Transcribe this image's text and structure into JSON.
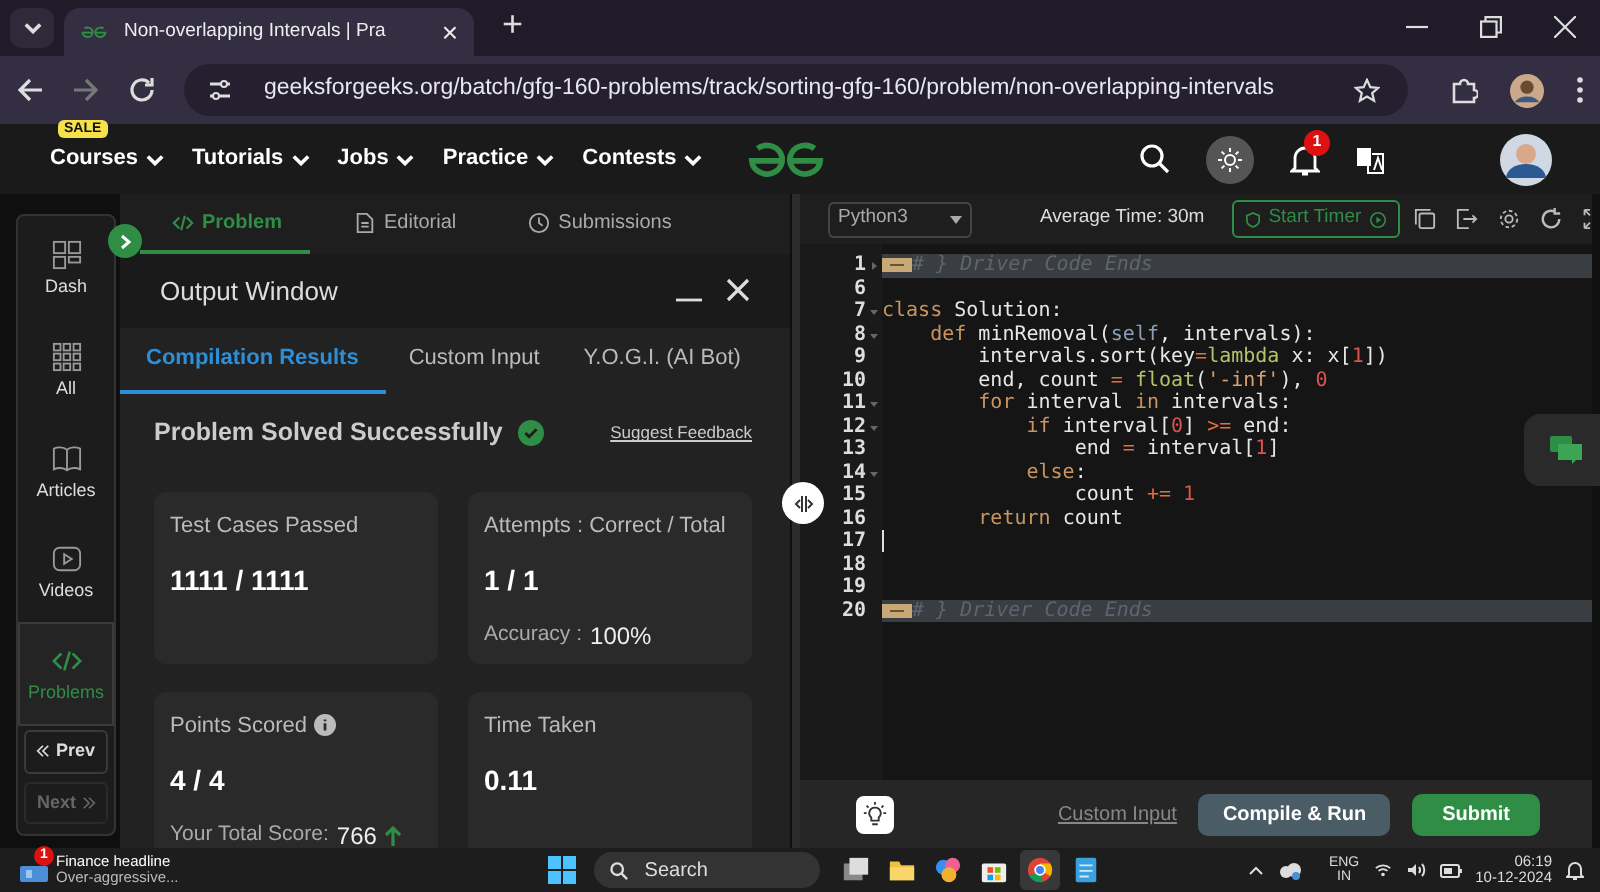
{
  "browser": {
    "tab": {
      "title": "Non-overlapping Intervals | Pra",
      "close": "×"
    },
    "new_tab": "+",
    "url": "geeksforgeeks.org/batch/gfg-160-problems/track/sorting-gfg-160/problem/non-overlapping-intervals"
  },
  "site_nav": {
    "items": [
      {
        "label": "Courses",
        "badge": "SALE"
      },
      {
        "label": "Tutorials"
      },
      {
        "label": "Jobs"
      },
      {
        "label": "Practice"
      },
      {
        "label": "Contests"
      }
    ],
    "notifications": "1"
  },
  "sidebar": {
    "items": [
      {
        "label": "Dash",
        "selected": false
      },
      {
        "label": "All",
        "selected": false
      },
      {
        "label": "Articles",
        "selected": false
      },
      {
        "label": "Videos",
        "selected": false
      },
      {
        "label": "Problems",
        "selected": true
      }
    ],
    "prev": {
      "label": "Prev",
      "disabled": false
    },
    "next": {
      "label": "Next",
      "disabled": true
    }
  },
  "problem_tabs": [
    {
      "label": "Problem",
      "selected": true
    },
    {
      "label": "Editorial",
      "selected": false
    },
    {
      "label": "Submissions",
      "selected": false
    }
  ],
  "output_window": {
    "title": "Output Window",
    "tabs": [
      {
        "label": "Compilation Results",
        "selected": true
      },
      {
        "label": "Custom Input",
        "selected": false
      },
      {
        "label": "Y.O.G.I. (AI Bot)",
        "selected": false
      }
    ],
    "status": "Problem Solved Successfully",
    "feedback_link": "Suggest Feedback",
    "cards": [
      {
        "title": "Test Cases Passed",
        "value": "1111 / 1111"
      },
      {
        "title": "Attempts : Correct / Total",
        "value": "1 / 1",
        "note_label": "Accuracy :",
        "note_value": "100%"
      },
      {
        "title": "Points Scored",
        "info": true,
        "value": "4 / 4",
        "note_label": "Your Total Score:",
        "note_value": "766",
        "rising": true
      },
      {
        "title": "Time Taken",
        "value": "0.11"
      }
    ]
  },
  "editor": {
    "language": "Python3",
    "average_time": "Average Time: 30m",
    "timer_button": "Start Timer",
    "lines": [
      {
        "number": "1",
        "foldable": true,
        "expanded": false,
        "collapsed_region": true,
        "tokens": [
          {
            "kind": "comment",
            "s": "# } Driver Code Ends"
          }
        ]
      },
      {
        "number": "6"
      },
      {
        "number": "7",
        "foldable": true,
        "expanded": true,
        "tokens": [
          {
            "kind": "kw",
            "s": "class"
          },
          {
            "kind": "plain",
            "s": " Solution:"
          }
        ]
      },
      {
        "number": "8",
        "foldable": true,
        "expanded": true,
        "tokens": [
          {
            "kind": "kw",
            "s": "    def"
          },
          {
            "kind": "plain",
            "s": " minRemoval("
          },
          {
            "kind": "self",
            "s": "self"
          },
          {
            "kind": "plain",
            "s": ", intervals):"
          }
        ]
      },
      {
        "number": "9",
        "tokens": [
          {
            "kind": "plain",
            "s": "        intervals.sort(key"
          },
          {
            "kind": "op",
            "s": "="
          },
          {
            "kind": "fn",
            "s": "lambda"
          },
          {
            "kind": "plain",
            "s": " x: x["
          },
          {
            "kind": "num",
            "s": "1"
          },
          {
            "kind": "plain",
            "s": "])"
          }
        ]
      },
      {
        "number": "10",
        "tokens": [
          {
            "kind": "plain",
            "s": "        end, count "
          },
          {
            "kind": "op",
            "s": "="
          },
          {
            "kind": "fn",
            "s": " float"
          },
          {
            "kind": "plain",
            "s": "("
          },
          {
            "kind": "str",
            "s": "'-inf'"
          },
          {
            "kind": "plain",
            "s": "), "
          },
          {
            "kind": "num",
            "s": "0"
          }
        ]
      },
      {
        "number": "11",
        "foldable": true,
        "expanded": true,
        "tokens": [
          {
            "kind": "kw",
            "s": "        for"
          },
          {
            "kind": "plain",
            "s": " interval "
          },
          {
            "kind": "kw",
            "s": "in"
          },
          {
            "kind": "plain",
            "s": " intervals:"
          }
        ]
      },
      {
        "number": "12",
        "foldable": true,
        "expanded": true,
        "tokens": [
          {
            "kind": "kw",
            "s": "            if"
          },
          {
            "kind": "plain",
            "s": " interval["
          },
          {
            "kind": "num",
            "s": "0"
          },
          {
            "kind": "plain",
            "s": "] "
          },
          {
            "kind": "op",
            "s": ">="
          },
          {
            "kind": "plain",
            "s": " end:"
          }
        ]
      },
      {
        "number": "13",
        "tokens": [
          {
            "kind": "plain",
            "s": "                end "
          },
          {
            "kind": "op",
            "s": "="
          },
          {
            "kind": "plain",
            "s": " interval["
          },
          {
            "kind": "num",
            "s": "1"
          },
          {
            "kind": "plain",
            "s": "]"
          }
        ]
      },
      {
        "number": "14",
        "foldable": true,
        "expanded": true,
        "tokens": [
          {
            "kind": "kw",
            "s": "            else"
          },
          {
            "kind": "plain",
            "s": ":"
          }
        ]
      },
      {
        "number": "15",
        "tokens": [
          {
            "kind": "plain",
            "s": "                count "
          },
          {
            "kind": "op",
            "s": "+="
          },
          {
            "kind": "num",
            "s": " 1"
          }
        ]
      },
      {
        "number": "16",
        "tokens": [
          {
            "kind": "kw",
            "s": "        return"
          },
          {
            "kind": "plain",
            "s": " count"
          }
        ]
      },
      {
        "number": "17",
        "cursor": true
      },
      {
        "number": "18"
      },
      {
        "number": "19"
      },
      {
        "number": "20",
        "collapsed_region": true,
        "tokens": [
          {
            "kind": "comment",
            "s": "# } Driver Code Ends"
          }
        ]
      }
    ]
  },
  "actions": {
    "custom_input": "Custom Input",
    "compile": "Compile & Run",
    "submit": "Submit"
  },
  "taskbar": {
    "news_badge": "1",
    "news_title": "Finance headline",
    "news_text": "Over-aggressive...",
    "search": "Search",
    "apps": [
      {
        "kind": "taskview",
        "selected": false
      },
      {
        "kind": "files",
        "selected": false
      },
      {
        "kind": "assistant",
        "selected": false
      },
      {
        "kind": "store",
        "selected": false
      },
      {
        "kind": "browser",
        "selected": true
      },
      {
        "kind": "notes",
        "selected": false
      }
    ],
    "language": "ENG",
    "region": "IN",
    "time": "06:19",
    "date": "10-12-2024"
  }
}
